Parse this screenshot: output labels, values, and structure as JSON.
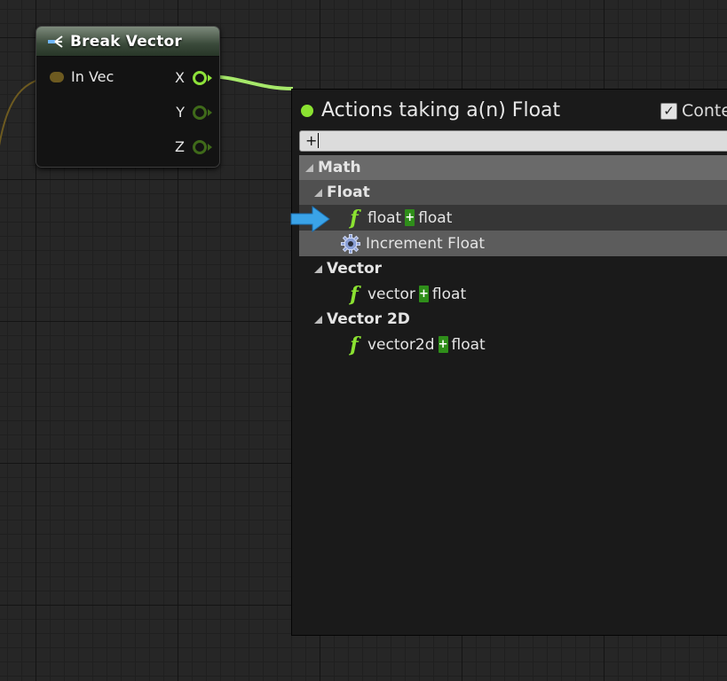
{
  "node": {
    "title": "Break Vector",
    "input_pin": "In Vec",
    "outputs": [
      "X",
      "Y",
      "Z"
    ]
  },
  "menu": {
    "title": "Actions taking a(n) Float",
    "context_label": "Conte",
    "context_checked": true,
    "search_value": "+",
    "search_operator": "+",
    "categories": [
      {
        "name": "Math"
      },
      {
        "name": "Float",
        "items": [
          {
            "icon": "function-icon",
            "left": "float",
            "right": "float"
          },
          {
            "icon": "gear-icon",
            "label": "Increment Float"
          }
        ]
      },
      {
        "name": "Vector",
        "items": [
          {
            "icon": "function-icon",
            "left": "vector",
            "right": "float"
          }
        ]
      },
      {
        "name": "Vector 2D",
        "items": [
          {
            "icon": "function-icon",
            "left": "vector2d",
            "right": "float"
          }
        ]
      }
    ]
  },
  "colors": {
    "float_pin": "#8be231",
    "vector_pin": "#6d5a20",
    "highlight_arrow": "#3aa3e8",
    "plus_badge": "#2f8e1a"
  }
}
